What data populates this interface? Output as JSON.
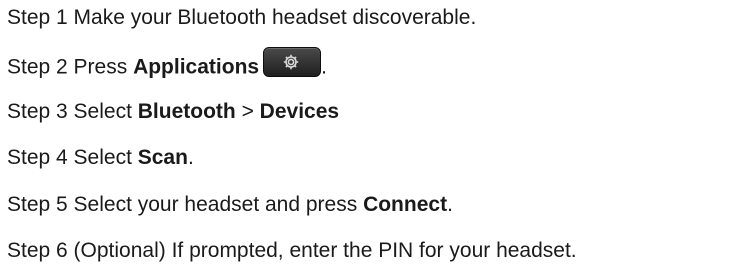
{
  "steps": [
    {
      "prefix": "Step 1 Make your Bluetooth headset discoverable."
    },
    {
      "prefix": "Step 2 Press ",
      "bold": "Applications",
      "suffix": "."
    },
    {
      "prefix": "Step 3 Select ",
      "bold1": "Bluetooth",
      "middle": " > ",
      "bold2": "Devices"
    },
    {
      "prefix": "Step 4 Select ",
      "bold": "Scan",
      "suffix": "."
    },
    {
      "prefix": "Step 5 Select your headset and press ",
      "bold": "Connect",
      "suffix": "."
    },
    {
      "prefix": "Step 6 (Optional) If prompted, enter the PIN for your headset."
    }
  ],
  "icons": {
    "applications_button": "gear-icon"
  },
  "colors": {
    "text": "#1a1a1a",
    "button": "#2e2e2e"
  }
}
